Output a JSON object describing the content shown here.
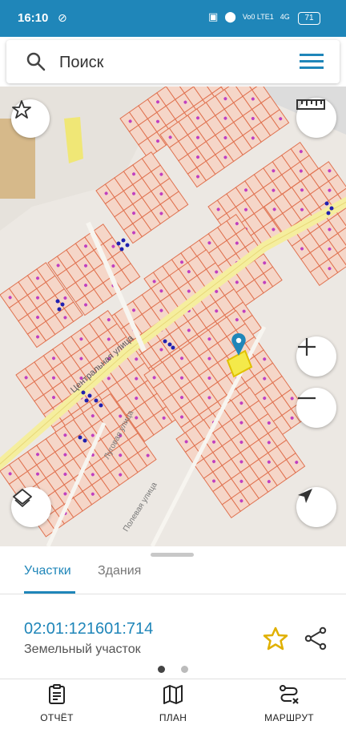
{
  "status_bar": {
    "time": "16:10",
    "network": "Vo0 LTE1",
    "signal": "4G",
    "battery": "71"
  },
  "search": {
    "placeholder": "Поиск"
  },
  "map": {
    "street_label": "Центральная улица",
    "street_label_2": "Луговая улица",
    "street_label_3": "Полевая улица",
    "colors": {
      "background": "#ece8e3",
      "parcel_fill": "#f5d6c8",
      "parcel_stroke": "#e07250",
      "road": "#f5ee9e",
      "building": "#d6b98a",
      "selected": "#f4e94a",
      "pin": "#1f86b9"
    }
  },
  "sheet": {
    "tabs": [
      {
        "label": "Участки",
        "active": true
      },
      {
        "label": "Здания",
        "active": false
      }
    ],
    "cadastral_number": "02:01:121601:714",
    "object_type": "Земельный участок",
    "page_indicator": {
      "current": 1,
      "total": 2
    }
  },
  "bottom_nav": [
    {
      "label": "ОТЧЁТ",
      "icon": "report-icon"
    },
    {
      "label": "ПЛАН",
      "icon": "map-plan-icon"
    },
    {
      "label": "МАРШРУТ",
      "icon": "route-icon"
    }
  ],
  "accent_color": "#1f86b9"
}
